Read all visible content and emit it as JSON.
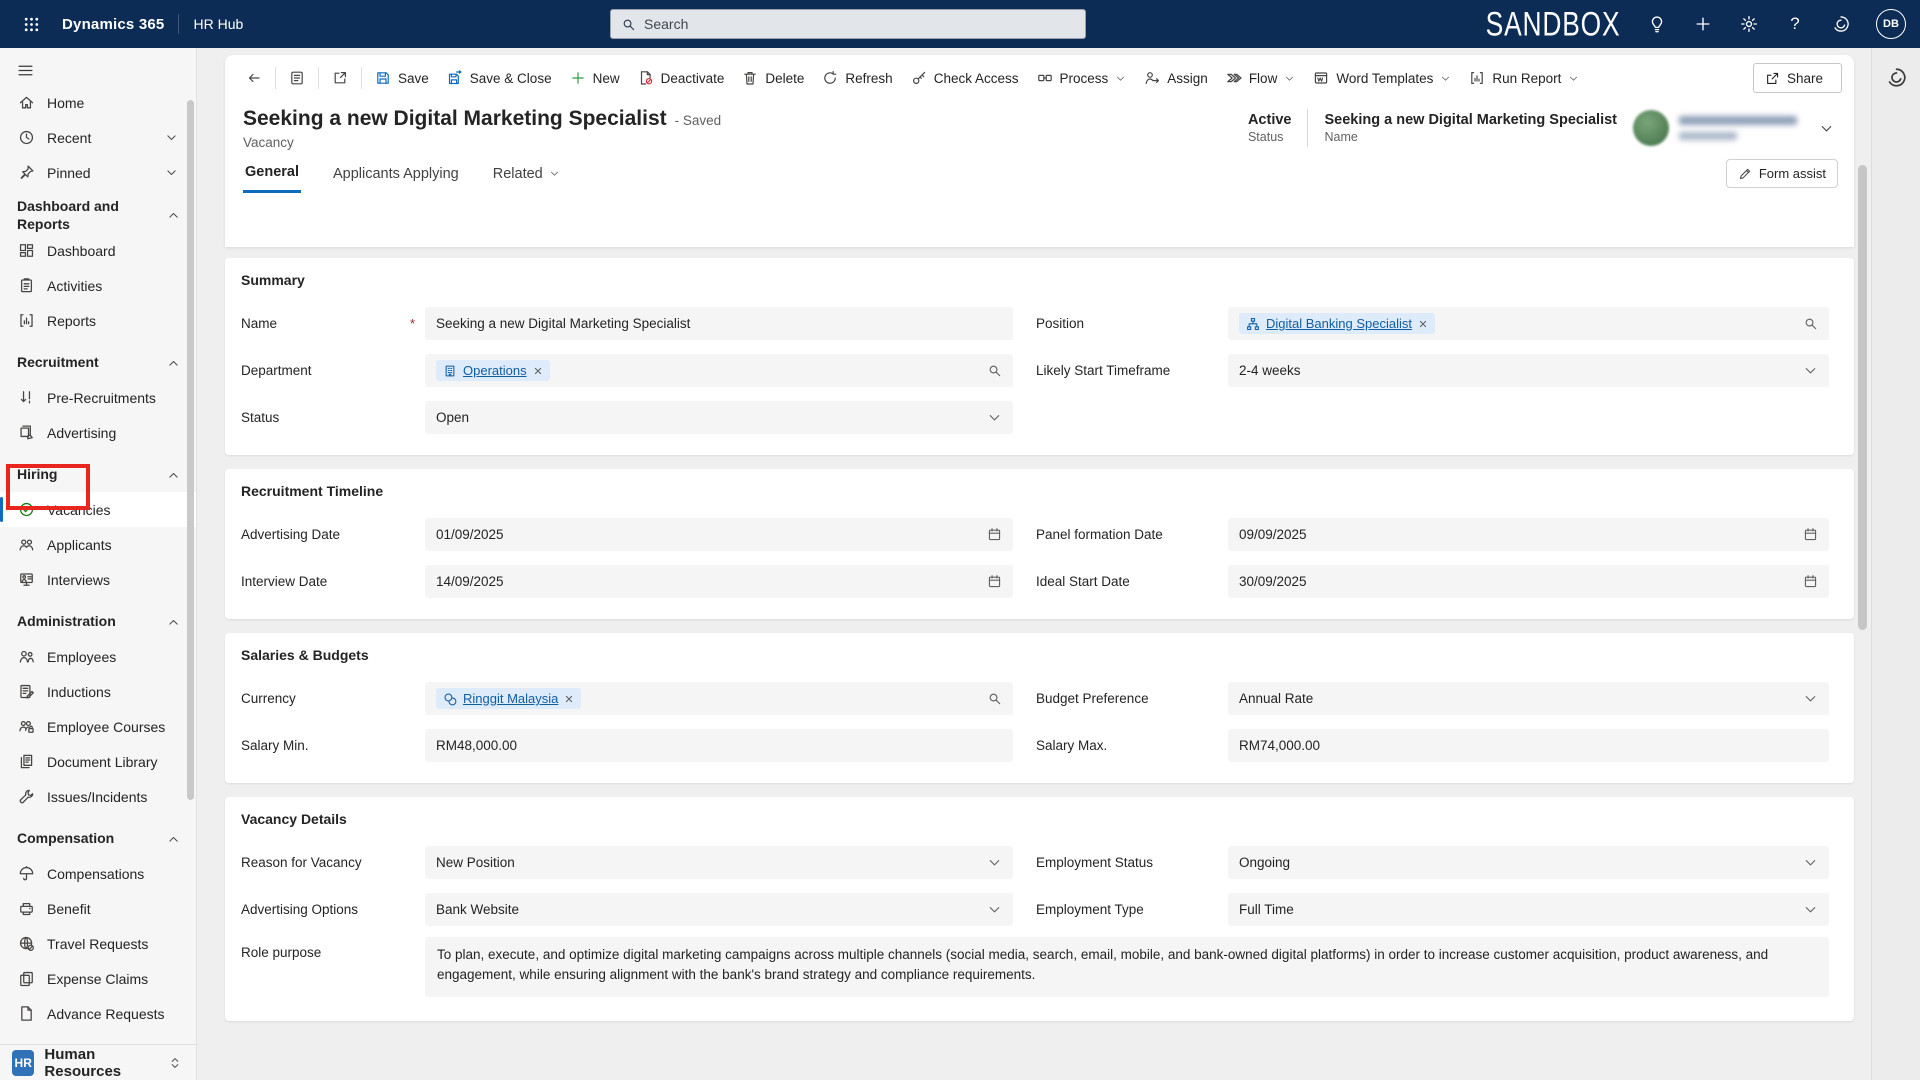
{
  "topbar": {
    "app_title": "Dynamics 365",
    "area_title": "HR Hub",
    "search_placeholder": "Search",
    "environment_badge": "SANDBOX",
    "avatar_initials": "DB"
  },
  "command_bar": {
    "commands": [
      {
        "label": "Save"
      },
      {
        "label": "Save & Close"
      },
      {
        "label": "New"
      },
      {
        "label": "Deactivate"
      },
      {
        "label": "Delete"
      },
      {
        "label": "Refresh"
      },
      {
        "label": "Check Access"
      },
      {
        "label": "Process"
      },
      {
        "label": "Assign"
      },
      {
        "label": "Flow"
      },
      {
        "label": "Word Templates"
      },
      {
        "label": "Run Report"
      }
    ],
    "share_label": "Share"
  },
  "record_header": {
    "title": "Seeking a new Digital Marketing Specialist",
    "save_status": "- Saved",
    "entity_label": "Vacancy",
    "status_value": "Active",
    "status_caption": "Status",
    "name_value": "Seeking a new Digital Marketing Specialist",
    "name_caption": "Name"
  },
  "tabs": {
    "general": "General",
    "applicants_applying": "Applicants Applying",
    "related": "Related",
    "form_assist": "Form assist"
  },
  "sidebar": {
    "home": "Home",
    "recent": "Recent",
    "pinned": "Pinned",
    "group_dashboard": "Dashboard and Reports",
    "dashboard": "Dashboard",
    "activities": "Activities",
    "reports": "Reports",
    "group_recruitment": "Recruitment",
    "pre_recruitments": "Pre-Recruitments",
    "advertising": "Advertising",
    "group_hiring": "Hiring",
    "vacancies": "Vacancies",
    "applicants": "Applicants",
    "interviews": "Interviews",
    "group_administration": "Administration",
    "employees": "Employees",
    "inductions": "Inductions",
    "employee_courses": "Employee Courses",
    "document_library": "Document Library",
    "issues": "Issues/Incidents",
    "group_compensation": "Compensation",
    "compensations": "Compensations",
    "benefit": "Benefit",
    "travel_requests": "Travel Requests",
    "expense_claims": "Expense Claims",
    "advance_requests": "Advance Requests",
    "footer_badge": "HR",
    "footer_label": "Human Resources"
  },
  "form": {
    "summary": {
      "title": "Summary",
      "name_label": "Name",
      "name_value": "Seeking a new Digital Marketing Specialist",
      "department_label": "Department",
      "department_value": "Operations",
      "status_label": "Status",
      "status_value": "Open",
      "position_label": "Position",
      "position_value": "Digital Banking Specialist",
      "timeframe_label": "Likely Start Timeframe",
      "timeframe_value": "2-4 weeks"
    },
    "timeline": {
      "title": "Recruitment Timeline",
      "advertising_date_label": "Advertising Date",
      "advertising_date_value": "01/09/2025",
      "interview_date_label": "Interview Date",
      "interview_date_value": "14/09/2025",
      "panel_date_label": "Panel formation Date",
      "panel_date_value": "09/09/2025",
      "ideal_start_label": "Ideal Start Date",
      "ideal_start_value": "30/09/2025"
    },
    "salaries": {
      "title": "Salaries & Budgets",
      "currency_label": "Currency",
      "currency_value": "Ringgit Malaysia",
      "salary_min_label": "Salary Min.",
      "salary_min_value": "RM48,000.00",
      "budget_label": "Budget Preference",
      "budget_value": "Annual Rate",
      "salary_max_label": "Salary Max.",
      "salary_max_value": "RM74,000.00"
    },
    "details": {
      "title": "Vacancy Details",
      "reason_label": "Reason for Vacancy",
      "reason_value": "New Position",
      "adv_options_label": "Advertising Options",
      "adv_options_value": "Bank Website",
      "emp_status_label": "Employment Status",
      "emp_status_value": "Ongoing",
      "emp_type_label": "Employment Type",
      "emp_type_value": "Full Time",
      "role_label": "Role purpose",
      "role_value": "To plan, execute, and optimize digital marketing campaigns across multiple channels (social media, search, email, mobile, and bank-owned digital platforms) in order to increase customer acquisition, product awareness, and engagement, while ensuring alignment with the bank's brand strategy and compliance requirements."
    }
  },
  "icons": {
    "waffle-icon": "3x3 dot grid",
    "search-icon": "magnifier",
    "lightbulb-icon": "bulb outline",
    "add-icon": "plus",
    "settings-icon": "gear",
    "help-icon": "?",
    "copilot-icon": "swirl in circle",
    "back-icon": "left arrow",
    "save-icon": "floppy disk (blue)",
    "new-icon": "plus (green)",
    "delete-icon": "trash can",
    "refresh-icon": "circular arrow",
    "key-icon": "key + magnifier",
    "share-icon": "box with outgoing arrow",
    "calendar-icon": "calendar",
    "chevron-down-icon": "v",
    "chevron-up-icon": "^",
    "close-icon": "x",
    "check-circle-icon": "green circled check",
    "pencil-icon": "pencil (form assist)"
  },
  "colors": {
    "topbar_navy": "#0c2b55",
    "accent_blue": "#0f6cbd",
    "link_blue": "#115ea3",
    "pill_bg": "#ddebfa",
    "selected_green": "#107c10",
    "annotation_red": "#e8261d",
    "page_gray": "#efefef"
  }
}
